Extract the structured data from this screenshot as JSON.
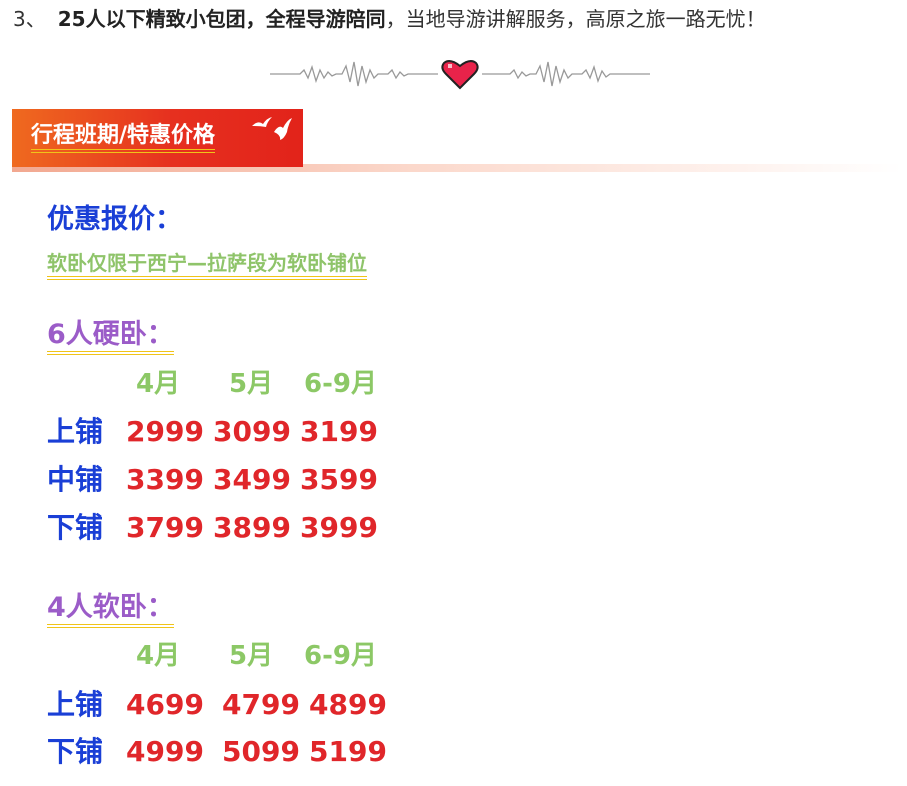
{
  "feature": {
    "number": "3、",
    "bold_text": "25人以下精致小包团，全程导游陪同",
    "plain_text": "，当地导游讲解服务，高原之旅一路无忧！"
  },
  "divider": {
    "icon": "heart-icon",
    "heart_color": "#e8234a"
  },
  "section": {
    "title": "行程班期/特惠价格",
    "bg_color": "#e6301f",
    "icon": "birds-icon"
  },
  "pricing": {
    "title": "优惠报价：",
    "note": "软卧仅限于西宁—拉萨段为软卧铺位"
  },
  "hard_sleeper": {
    "title": "6人硬卧：",
    "months": [
      "4月",
      "5月",
      "6-9月"
    ],
    "rows": [
      {
        "berth": "上铺",
        "prices": [
          "2999",
          "3099",
          "3199"
        ]
      },
      {
        "berth": "中铺",
        "prices": [
          "3399",
          "3499",
          "3599"
        ]
      },
      {
        "berth": "下铺",
        "prices": [
          "3799",
          "3899",
          "3999"
        ]
      }
    ]
  },
  "soft_sleeper": {
    "title": "4人软卧：",
    "months": [
      "4月",
      "5月",
      "6-9月"
    ],
    "rows": [
      {
        "berth": "上铺",
        "prices": [
          "4699",
          "4799",
          "4899"
        ]
      },
      {
        "berth": "下铺",
        "prices": [
          "4999",
          "5099",
          "5199"
        ]
      }
    ]
  },
  "colors": {
    "blue": "#1a3fd6",
    "red": "#e0262a",
    "green": "#8cc866",
    "purple": "#9b5cc8"
  }
}
